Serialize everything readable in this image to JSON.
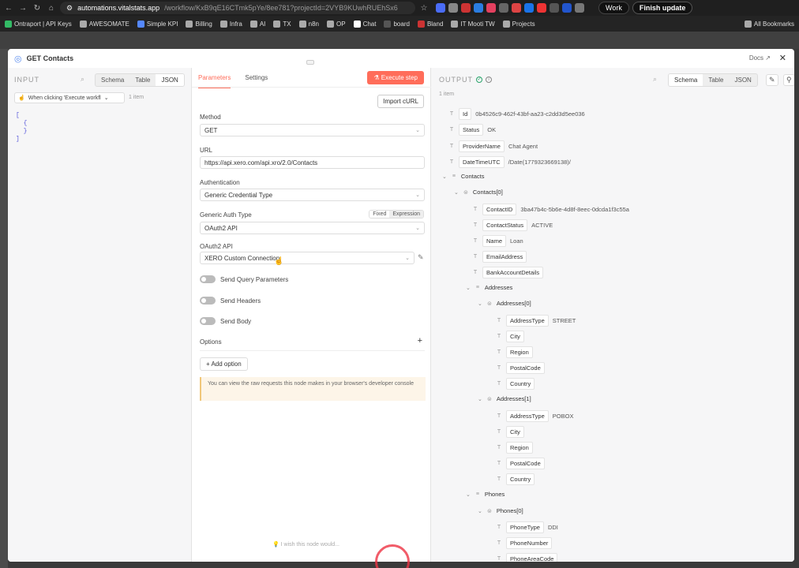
{
  "browser": {
    "url_host": "automations.vitalstats.app",
    "url_rest": "/workflow/KxB9qE16CTmk5pYe/8ee781?projectId=2VYB9KUwhRUEhSx6",
    "profile_label": "Work",
    "update_label": "Finish update",
    "bookmarks": [
      "Ontraport | API Keys",
      "AWESOMATE",
      "Simple KPI",
      "Billing",
      "Infra",
      "AI",
      "TX",
      "n8n",
      "OP",
      "Chat",
      "board",
      "Bland",
      "IT Mooti TW",
      "Projects"
    ],
    "all_bookmarks": "All Bookmarks"
  },
  "modal": {
    "title": "GET Contacts",
    "docs": "Docs"
  },
  "input": {
    "header": "INPUT",
    "views": [
      "Schema",
      "Table",
      "JSON"
    ],
    "active_view": "JSON",
    "trigger": "When clicking 'Execute workfl",
    "items": "1 item",
    "json_lines": [
      "[",
      "  {",
      "  }",
      "]"
    ]
  },
  "params": {
    "tabs": [
      "Parameters",
      "Settings"
    ],
    "execute": "Execute step",
    "import": "Import cURL",
    "method_label": "Method",
    "method": "GET",
    "url_label": "URL",
    "url": "https://api.xero.com/api.xro/2.0/Contacts",
    "auth_label": "Authentication",
    "auth": "Generic Credential Type",
    "gat_label": "Generic Auth Type",
    "fixed": "Fixed",
    "expression": "Expression",
    "gat": "OAuth2 API",
    "oauth_label": "OAuth2 API",
    "oauth": "XERO Custom Connection",
    "send_query": "Send Query Parameters",
    "send_headers": "Send Headers",
    "send_body": "Send Body",
    "options": "Options",
    "add_option": "Add option",
    "note": "You can view the raw requests this node makes in your browser's developer console",
    "wish": "I wish this node would..."
  },
  "output": {
    "header": "OUTPUT",
    "views": [
      "Schema",
      "Table",
      "JSON"
    ],
    "active_view": "Schema",
    "items": "1 item",
    "rows": [
      {
        "k": "Id",
        "v": "0b4526c9-462f-43bf-aa23-c2dd3d5ee036",
        "type": "T"
      },
      {
        "k": "Status",
        "v": "OK",
        "type": "T"
      },
      {
        "k": "ProviderName",
        "v": "Chat Agent",
        "type": "T"
      },
      {
        "k": "DateTimeUTC",
        "v": "/Date(1779323669138)/",
        "type": "T"
      },
      {
        "k": "Contacts",
        "v": "",
        "type": "list"
      },
      {
        "k": "Contacts[0]",
        "v": "",
        "type": "obj"
      },
      {
        "k": "ContactID",
        "v": "3ba47b4c-5b6e-4d8f-8eec-0dcda1f3c55a",
        "type": "T"
      },
      {
        "k": "ContactStatus",
        "v": "ACTIVE",
        "type": "T"
      },
      {
        "k": "Name",
        "v": "Loan",
        "type": "T"
      },
      {
        "k": "EmailAddress",
        "v": "",
        "type": "T"
      },
      {
        "k": "BankAccountDetails",
        "v": "",
        "type": "T"
      },
      {
        "k": "Addresses",
        "v": "",
        "type": "list"
      },
      {
        "k": "Addresses[0]",
        "v": "",
        "type": "obj"
      },
      {
        "k": "AddressType",
        "v": "STREET",
        "type": "T"
      },
      {
        "k": "City",
        "v": "",
        "type": "T"
      },
      {
        "k": "Region",
        "v": "",
        "type": "T"
      },
      {
        "k": "PostalCode",
        "v": "",
        "type": "T"
      },
      {
        "k": "Country",
        "v": "",
        "type": "T"
      },
      {
        "k": "Addresses[1]",
        "v": "",
        "type": "obj"
      },
      {
        "k": "AddressType",
        "v": "POBOX",
        "type": "T"
      },
      {
        "k": "City",
        "v": "",
        "type": "T"
      },
      {
        "k": "Region",
        "v": "",
        "type": "T"
      },
      {
        "k": "PostalCode",
        "v": "",
        "type": "T"
      },
      {
        "k": "Country",
        "v": "",
        "type": "T"
      },
      {
        "k": "Phones",
        "v": "",
        "type": "list"
      },
      {
        "k": "Phones[0]",
        "v": "",
        "type": "obj"
      },
      {
        "k": "PhoneType",
        "v": "DDI",
        "type": "T"
      },
      {
        "k": "PhoneNumber",
        "v": "",
        "type": "T"
      },
      {
        "k": "PhoneAreaCode",
        "v": "",
        "type": "T"
      }
    ]
  },
  "colors": {
    "accent": "#ff6d5a",
    "success": "#29a36a"
  }
}
